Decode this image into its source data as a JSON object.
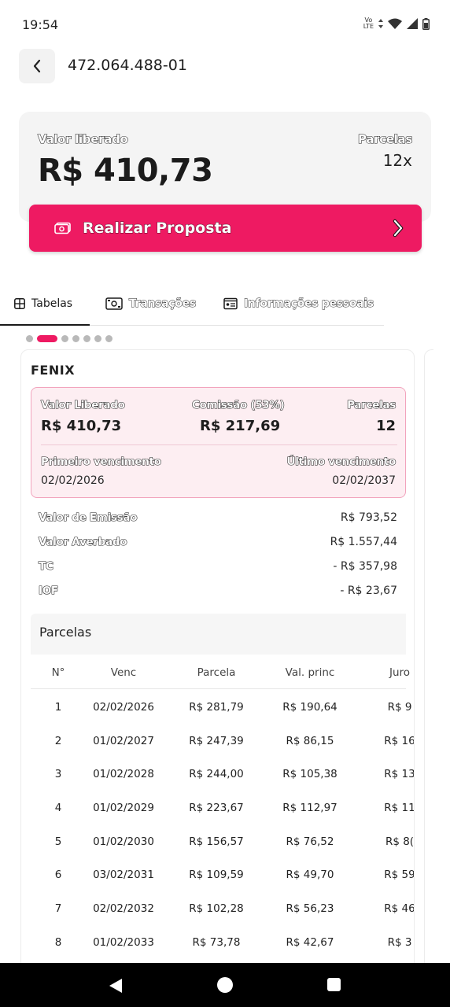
{
  "status_bar": {
    "time": "19:54",
    "network": "Vo LTE",
    "icons": [
      "volte-icon",
      "data-arrows-icon",
      "wifi-icon",
      "signal-icon",
      "battery-icon"
    ]
  },
  "header": {
    "title": "472.064.488-01"
  },
  "summary": {
    "valor_label": "Valor liberado",
    "valor": "R$ 410,73",
    "parcelas_label": "Parcelas",
    "parcelas": "12x"
  },
  "proposal_button": {
    "label": "Realizar Proposta"
  },
  "tabs": [
    {
      "label": "Tabelas",
      "icon": "table-icon",
      "active": true
    },
    {
      "label": "Transações",
      "icon": "money-icon",
      "active": false
    },
    {
      "label": "Informações pessoais",
      "icon": "id-card-icon",
      "active": false
    }
  ],
  "pager": {
    "total": 7,
    "active": 1
  },
  "card": {
    "title": "FENIX",
    "highlight": {
      "valor_label": "Valor Liberado",
      "valor": "R$ 410,73",
      "comissao_label": "Comissão (53%)",
      "comissao": "R$ 217,69",
      "parcelas_label": "Parcelas",
      "parcelas": "12",
      "primeiro_label": "Primeiro vencimento",
      "primeiro": "02/02/2026",
      "ultimo_label": "Último vencimento",
      "ultimo": "02/02/2037"
    },
    "details": [
      {
        "label": "Valor de Emissão",
        "value": "R$ 793,52"
      },
      {
        "label": "Valor Averbado",
        "value": "R$ 1.557,44"
      },
      {
        "label": "TC",
        "value": "- R$ 357,98"
      },
      {
        "label": "IOF",
        "value": "- R$ 23,67"
      }
    ],
    "parcelas_title": "Parcelas",
    "columns": [
      "N°",
      "Venc",
      "Parcela",
      "Val. princ",
      "Juro"
    ],
    "rows": [
      [
        "1",
        "02/02/2026",
        "R$ 281,79",
        "R$ 190,64",
        "R$ 9"
      ],
      [
        "2",
        "01/02/2027",
        "R$ 247,39",
        "R$ 86,15",
        "R$ 16"
      ],
      [
        "3",
        "01/02/2028",
        "R$ 244,00",
        "R$ 105,38",
        "R$ 13"
      ],
      [
        "4",
        "01/02/2029",
        "R$ 223,67",
        "R$ 112,97",
        "R$ 11"
      ],
      [
        "5",
        "01/02/2030",
        "R$ 156,57",
        "R$ 76,52",
        "R$ 8("
      ],
      [
        "6",
        "03/02/2031",
        "R$ 109,59",
        "R$ 49,70",
        "R$ 59"
      ],
      [
        "7",
        "02/02/2032",
        "R$ 102,28",
        "R$ 56,23",
        "R$ 46"
      ],
      [
        "8",
        "01/02/2033",
        "R$ 73,78",
        "R$ 42,67",
        "R$ 3"
      ]
    ]
  },
  "colors": {
    "accent": "#ee1a62",
    "highlight_bg": "#fdeef2",
    "highlight_border": "#f2a4bd"
  }
}
